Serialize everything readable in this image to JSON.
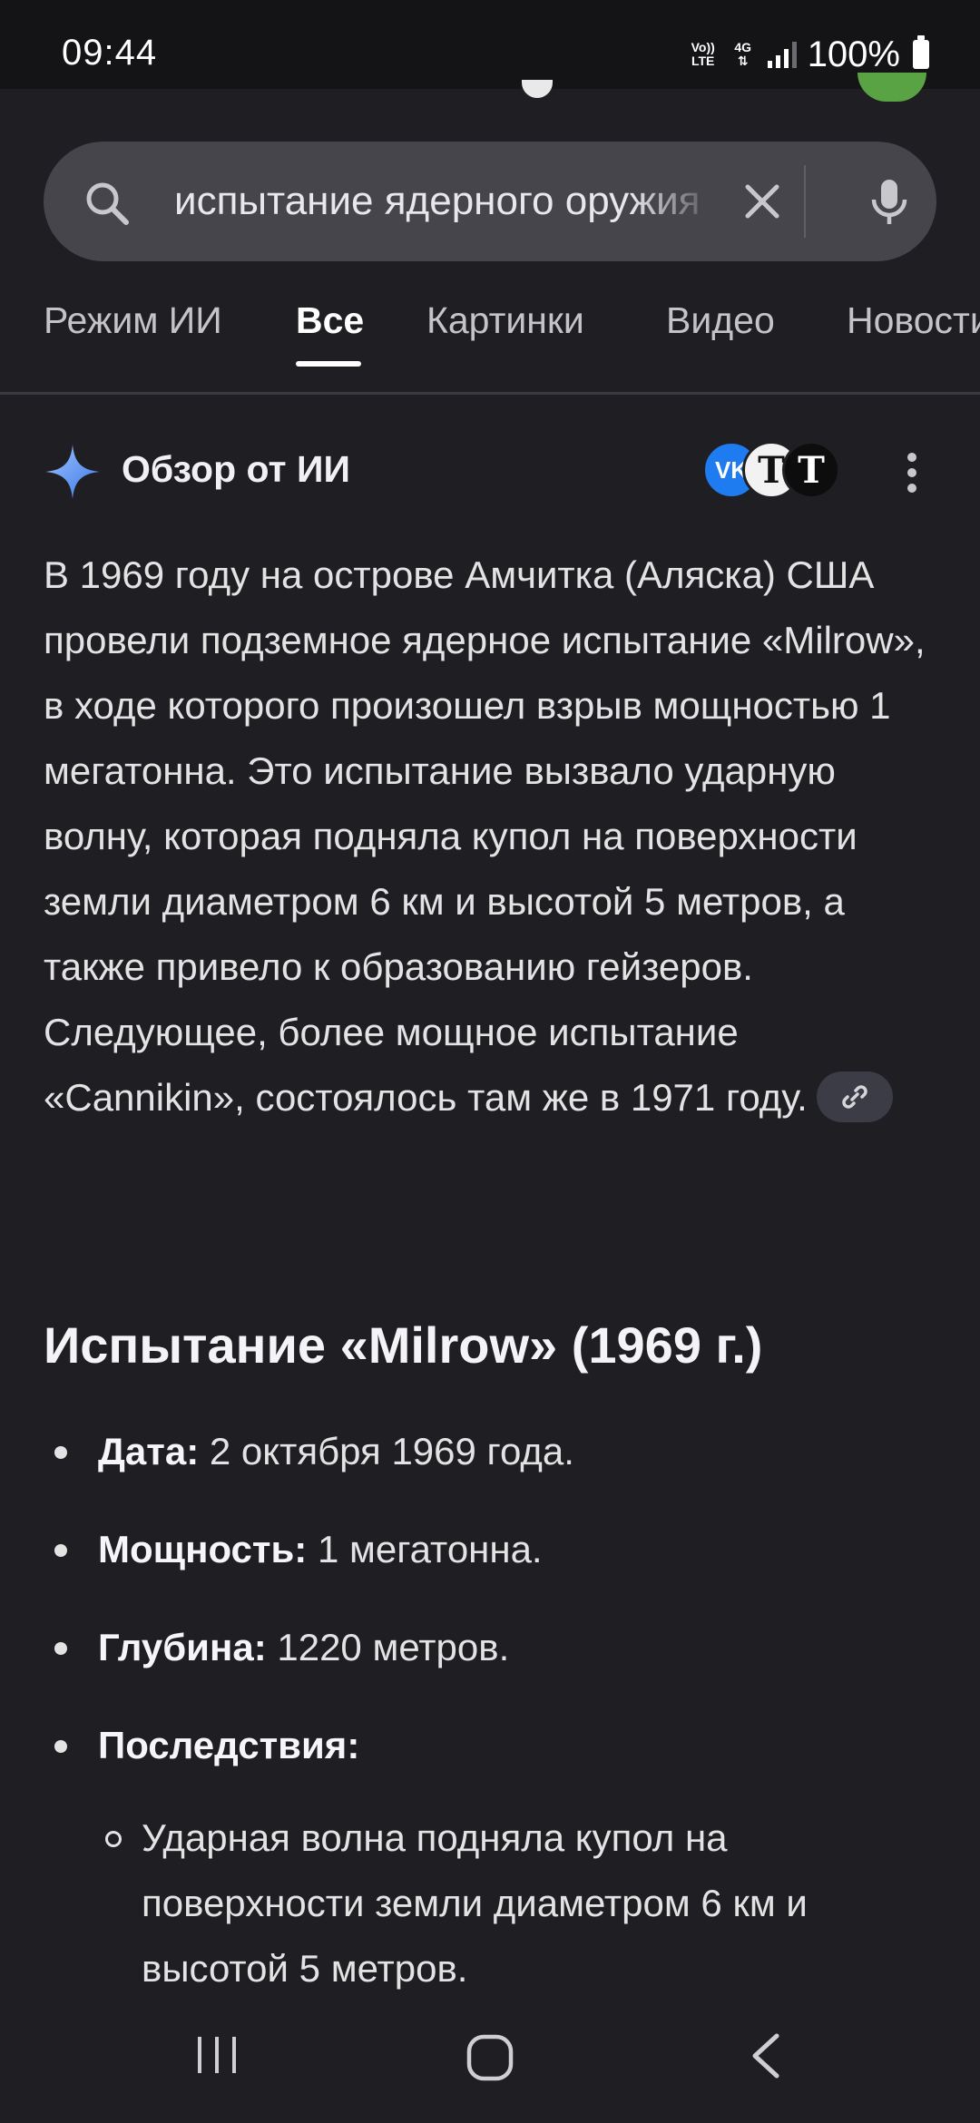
{
  "status_bar": {
    "time": "09:44",
    "volte_label": "Vo)) LTE",
    "network_label": "4G",
    "battery": "100%"
  },
  "search": {
    "query": "испытание ядерного оружия",
    "icons": {
      "search": "search-icon",
      "clear": "close-icon",
      "voice": "mic-icon"
    }
  },
  "tabs": [
    {
      "label": "Режим ИИ",
      "active": false
    },
    {
      "label": "Все",
      "active": true
    },
    {
      "label": "Картинки",
      "active": false
    },
    {
      "label": "Видео",
      "active": false
    },
    {
      "label": "Новости",
      "active": false
    }
  ],
  "ai_overview": {
    "title": "Обзор от ИИ",
    "sources": [
      "VK",
      "T",
      "T"
    ],
    "summary": "В 1969 году на острове Амчитка (Аляска) США провели подземное ядерное испытание «Milrow», в ходе которого произошел взрыв мощностью 1 мегатонна. Это испытание вызвало ударную волну, которая подняла купол на поверхности земли диаметром 6 км и высотой 5 метров, а также привело к образованию гейзеров. Следующее, более мощное испытание «Cannikin», состоялось там же в 1971 году."
  },
  "section": {
    "heading": "Испытание «Milrow» (1969 г.)",
    "facts": [
      {
        "label": "Дата:",
        "value": "2 октября 1969 года."
      },
      {
        "label": "Мощность:",
        "value": "1 мегатонна."
      },
      {
        "label": "Глубина:",
        "value": "1220 метров."
      },
      {
        "label": "Последствия:",
        "value": ""
      }
    ],
    "sub_facts": [
      "Ударная волна подняла купол на поверхности земли диаметром 6 км и высотой 5 метров."
    ]
  },
  "colors": {
    "background": "#1f1f23",
    "search_bar": "#45454b",
    "accent_sparkle": "#4f8df5",
    "vk_blue": "#1e7bf0"
  }
}
